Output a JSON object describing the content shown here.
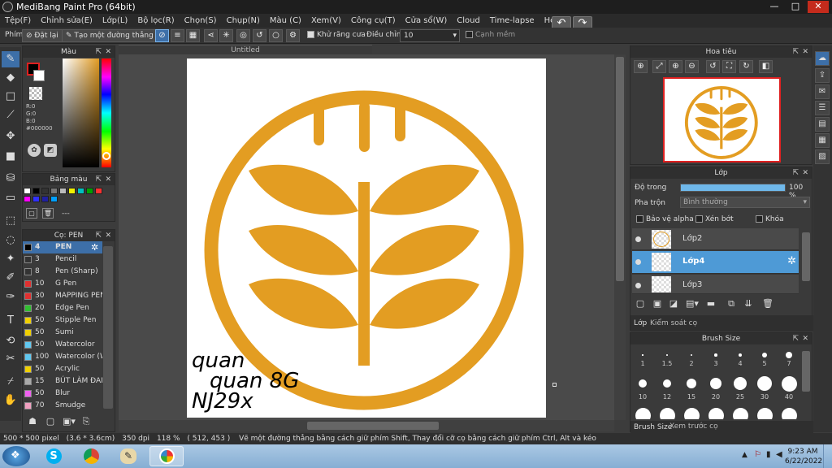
{
  "window": {
    "title": "MediBang Paint Pro (64bit)",
    "min": "—",
    "max": "□",
    "close": "✕"
  },
  "menu": [
    "Tệp(F)",
    "Chỉnh sửa(E)",
    "Lớp(L)",
    "Bộ lọc(R)",
    "Chọn(S)",
    "Chụp(N)",
    "Màu (C)",
    "Xem(V)",
    "Công cụ(T)",
    "Cửa sổ(W)",
    "Cloud",
    "Time-lapse",
    "Help"
  ],
  "toolbar": {
    "label": "Phím",
    "reset": "Đặt lại",
    "straight_line": "Tạo một đường thẳng",
    "antialias": "Khử răng cưa",
    "adjust": "Điều chỉnh",
    "adjust_value": "10",
    "snap": "Cạnh mềm"
  },
  "color_panel": {
    "title": "Màu",
    "r": "R:0",
    "g": "G:0",
    "b": "B:0",
    "hex": "#000000"
  },
  "palette_panel": {
    "title": "Bảng màu",
    "swatches": [
      "#ffffff",
      "#000000",
      "#333333",
      "#777777",
      "#bbbbbb",
      "#f0f000",
      "#00c0c0",
      "#00a000",
      "#ff3030",
      "#ff00ff",
      "#3030ff",
      "#2020a0",
      "#00a0ff"
    ],
    "placeholder": "---"
  },
  "brush_panel": {
    "title": "Cọ: PEN",
    "items": [
      {
        "size": "4",
        "name": "PEN",
        "color": "#000000"
      },
      {
        "size": "3",
        "name": "Pencil",
        "color": "#333333"
      },
      {
        "size": "8",
        "name": "Pen (Sharp)",
        "color": "#333333"
      },
      {
        "size": "10",
        "name": "G Pen",
        "color": "#e03030"
      },
      {
        "size": "30",
        "name": "MAPPING PEN",
        "color": "#e03030"
      },
      {
        "size": "20",
        "name": "Edge Pen",
        "color": "#30c030"
      },
      {
        "size": "50",
        "name": "Stipple Pen",
        "color": "#f0d000"
      },
      {
        "size": "50",
        "name": "Sumi",
        "color": "#f0d000"
      },
      {
        "size": "50",
        "name": "Watercolor",
        "color": "#60c8f0"
      },
      {
        "size": "100",
        "name": "Watercolor (W",
        "color": "#60c8f0"
      },
      {
        "size": "50",
        "name": "Acrylic",
        "color": "#f0d000"
      },
      {
        "size": "15",
        "name": "BÚT LÀM ĐAM",
        "color": "#aaaaaa"
      },
      {
        "size": "50",
        "name": "Blur",
        "color": "#f060f0"
      },
      {
        "size": "70",
        "name": "Smudge",
        "color": "#f0a0c0"
      }
    ]
  },
  "document": {
    "tab": "Untitled",
    "accent": "#e39d22",
    "handwriting": [
      "quan",
      "quan 8G",
      "NJ29x"
    ]
  },
  "navigator": {
    "title": "Hoa tiêu"
  },
  "layer_panel": {
    "title": "Lớp",
    "opacity_label": "Độ trong",
    "opacity_value": "100 %",
    "opacity": 1.0,
    "blend_label": "Pha trộn",
    "blend_value": "Bình thường",
    "protect_alpha": "Bảo vệ alpha",
    "clipping": "Xén bớt",
    "lock": "Khóa",
    "layers": [
      "Lớp2",
      "Lớp4",
      "Lớp3"
    ],
    "tab_layer": "Lớp",
    "tab_brush_control": "Kiểm soát cọ"
  },
  "brush_size_panel": {
    "title": "Brush Size",
    "row1": [
      "1",
      "1.5",
      "2",
      "3",
      "4",
      "5",
      "7"
    ],
    "row2": [
      "10",
      "12",
      "15",
      "20",
      "25",
      "30",
      "40"
    ],
    "tab_size": "Brush Size",
    "tab_preview": "Xem trước cọ"
  },
  "status": {
    "size": "500 * 500 pixel",
    "physical": "(3.6 * 3.6cm)",
    "dpi": "350 dpi",
    "zoom": "118 %",
    "coords": "( 512, 453 )",
    "hint": "Vẽ một đường thẳng bằng cách giữ phím Shift, Thay đổi cỡ cọ bằng cách giữ phím Ctrl, Alt và kéo"
  },
  "taskbar": {
    "time": "9:23 AM",
    "date": "6/22/2022"
  }
}
